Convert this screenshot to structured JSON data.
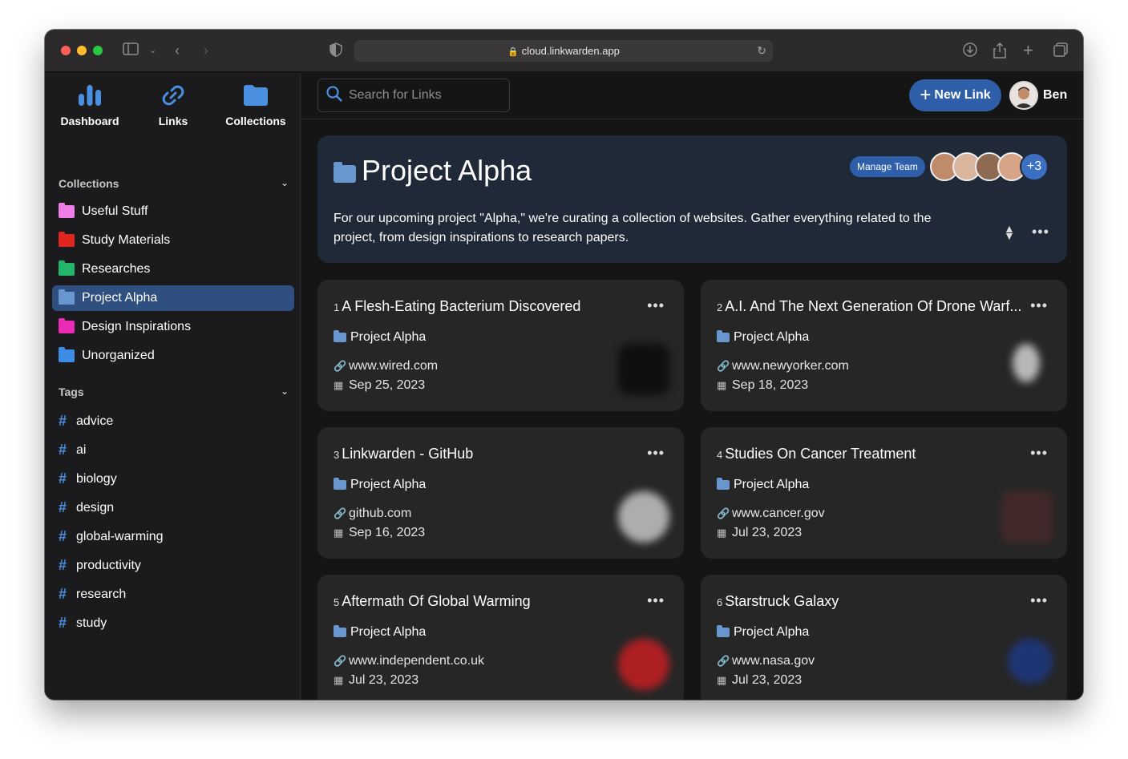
{
  "browser": {
    "url": "cloud.linkwarden.app"
  },
  "topnav": [
    {
      "label": "Dashboard",
      "icon": "bar-chart-icon"
    },
    {
      "label": "Links",
      "icon": "link-icon"
    },
    {
      "label": "Collections",
      "icon": "folder-icon"
    }
  ],
  "sidebar": {
    "collections_heading": "Collections",
    "collections": [
      {
        "label": "Useful Stuff",
        "color": "#f07ce8"
      },
      {
        "label": "Study Materials",
        "color": "#e0261e"
      },
      {
        "label": "Researches",
        "color": "#23b56b"
      },
      {
        "label": "Project Alpha",
        "color": "#6897d0"
      },
      {
        "label": "Design Inspirations",
        "color": "#ec2ab6"
      },
      {
        "label": "Unorganized",
        "color": "#3d8ce6"
      }
    ],
    "tags_heading": "Tags",
    "tags": [
      "advice",
      "ai",
      "biology",
      "design",
      "global-warming",
      "productivity",
      "research",
      "study"
    ]
  },
  "topbar": {
    "search_placeholder": "Search for Links",
    "new_link_label": "New Link",
    "user_name": "Ben"
  },
  "collection": {
    "title": "Project Alpha",
    "manage_label": "Manage Team",
    "more_members": "+3",
    "description": "For our upcoming project \"Alpha,\" we're curating a collection of websites. Gather everything related to the project, from design inspirations to research papers."
  },
  "links": [
    {
      "num": "1",
      "title": "A Flesh-Eating Bacterium Discovered",
      "collection": "Project Alpha",
      "url": "www.wired.com",
      "date": "Sep 25, 2023",
      "thumb_color": "#111111"
    },
    {
      "num": "2",
      "title": "A.I. And The Next Generation Of Drone Warf...",
      "collection": "Project Alpha",
      "url": "www.newyorker.com",
      "date": "Sep 18, 2023",
      "thumb_color": "#e6e6e6"
    },
    {
      "num": "3",
      "title": "Linkwarden - GitHub",
      "collection": "Project Alpha",
      "url": "github.com",
      "date": "Sep 16, 2023",
      "thumb_color": "#d9d9d9"
    },
    {
      "num": "4",
      "title": "Studies On Cancer Treatment",
      "collection": "Project Alpha",
      "url": "www.cancer.gov",
      "date": "Jul 23, 2023",
      "thumb_color": "#7a2b2b"
    },
    {
      "num": "5",
      "title": "Aftermath Of Global Warming",
      "collection": "Project Alpha",
      "url": "www.independent.co.uk",
      "date": "Jul 23, 2023",
      "thumb_color": "#d01e22"
    },
    {
      "num": "6",
      "title": "Starstruck Galaxy",
      "collection": "Project Alpha",
      "url": "www.nasa.gov",
      "date": "Jul 23, 2023",
      "thumb_color": "#1d3a8a"
    }
  ]
}
